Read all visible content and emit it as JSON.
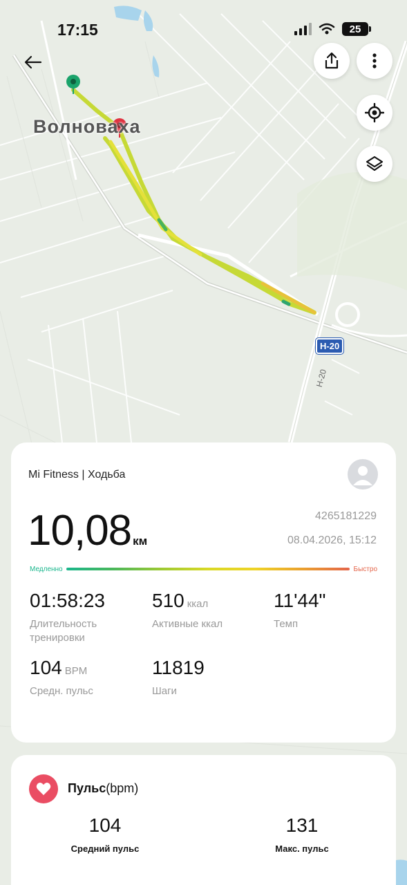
{
  "status_bar": {
    "time": "17:15",
    "battery": "25"
  },
  "map": {
    "city": "Волноваха",
    "road_badge": "H-20",
    "road_label": "H-20"
  },
  "workout": {
    "source": "Mi Fitness | Ходьба",
    "distance_value": "10,08",
    "distance_unit": "км",
    "id": "4265181229",
    "datetime": "08.04.2026, 15:12",
    "speed_min_label": "Медленно",
    "speed_max_label": "Быстро",
    "stats": {
      "duration_value": "01:58:23",
      "duration_label": "Длительность тренировки",
      "calories_value": "510",
      "calories_unit": "ккал",
      "calories_label": "Активные ккал",
      "pace_value": "11'44\"",
      "pace_label": "Темп",
      "heart_value": "104",
      "heart_unit": "BPM",
      "heart_label": "Средн. пульс",
      "steps_value": "11819",
      "steps_label": "Шаги"
    }
  },
  "pulse": {
    "title_bold": "Пульс",
    "title_unit": "(bpm)",
    "avg_value": "104",
    "avg_label": "Средний пульс",
    "max_value": "131",
    "max_label": "Макс. пульс"
  },
  "icons": {
    "back": "arrow-left-icon",
    "share": "share-icon",
    "more": "more-vertical-icon",
    "locate": "locate-icon",
    "layers": "layers-icon",
    "heart": "heart-icon",
    "avatar": "user-avatar-icon"
  },
  "colors": {
    "accent_heart": "#ea4d63",
    "speed_slow": "#19b68c",
    "speed_fast": "#e4654a",
    "start_marker": "#1aa36b",
    "end_marker": "#e0313f"
  }
}
